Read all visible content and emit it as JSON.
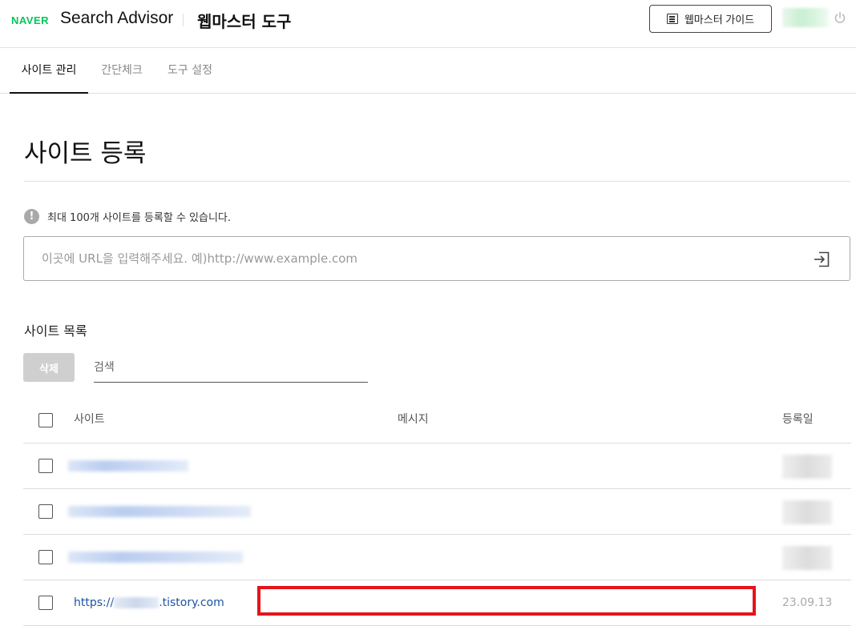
{
  "header": {
    "brand": "NAVER",
    "product": "Search Advisor",
    "tool_title": "웹마스터 도구",
    "guide_button": "웹마스터 가이드",
    "icons": {
      "guide": "document-list-icon",
      "logout": "power-icon"
    }
  },
  "tabs": [
    {
      "label": "사이트 관리",
      "active": true
    },
    {
      "label": "간단체크",
      "active": false
    },
    {
      "label": "도구 설정",
      "active": false
    }
  ],
  "main": {
    "title": "사이트 등록",
    "notice": "최대 100개 사이트를 등록할 수 있습니다.",
    "notice_icon": "!",
    "url_input": {
      "placeholder": "이곳에 URL을 입력해주세요. 예)http://www.example.com",
      "value": ""
    },
    "site_list": {
      "title": "사이트 목록",
      "delete_button": "삭제",
      "search_placeholder": "검색",
      "columns": {
        "site": "사이트",
        "message": "메시지",
        "date": "등록일"
      },
      "rows": [
        {
          "site": "",
          "message": "",
          "date": "",
          "redacted": true
        },
        {
          "site": "",
          "message": "",
          "date": "",
          "redacted": true
        },
        {
          "site": "",
          "message": "",
          "date": "",
          "redacted": true
        },
        {
          "site_prefix": "https://",
          "site_suffix": ".tistory.com",
          "message": "",
          "date": "23.09.13",
          "highlighted": true
        }
      ]
    }
  },
  "colors": {
    "brand_green": "#03c75a",
    "link": "#1c53a0",
    "highlight": "#e5141a",
    "disabled_button": "#cfcfcf"
  }
}
